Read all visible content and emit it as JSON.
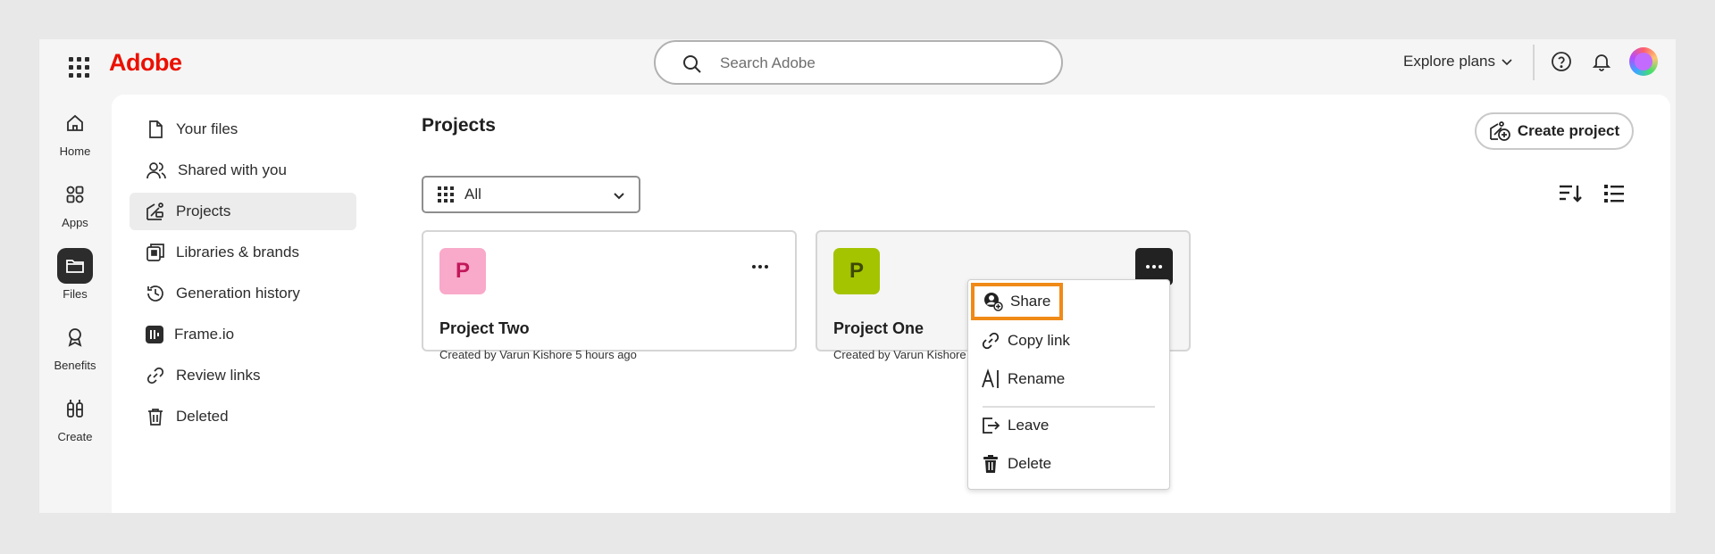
{
  "brand": {
    "logo": "Adobe",
    "color": "#eb1000"
  },
  "header": {
    "search_placeholder": "Search Adobe",
    "explore_label": "Explore plans",
    "icons": [
      "apps-grid-icon",
      "search-icon",
      "help-icon",
      "bell-icon",
      "avatar"
    ]
  },
  "rail": {
    "items": [
      {
        "label": "Home",
        "icon": "home-icon"
      },
      {
        "label": "Apps",
        "icon": "apps-icon"
      },
      {
        "label": "Files",
        "icon": "folder-icon",
        "active": true
      },
      {
        "label": "Benefits",
        "icon": "badge-icon"
      },
      {
        "label": "Create",
        "icon": "create-icon"
      }
    ]
  },
  "sidenav": {
    "items": [
      {
        "label": "Your files",
        "icon": "file-icon"
      },
      {
        "label": "Shared with you",
        "icon": "people-icon"
      },
      {
        "label": "Projects",
        "icon": "project-icon",
        "active": true
      },
      {
        "label": "Libraries & brands",
        "icon": "library-icon"
      },
      {
        "label": "Generation history",
        "icon": "history-icon"
      },
      {
        "label": "Frame.io",
        "icon": "frameio-icon"
      },
      {
        "label": "Review links",
        "icon": "link-icon"
      },
      {
        "label": "Deleted",
        "icon": "trash-icon"
      }
    ]
  },
  "main": {
    "title": "Projects",
    "create_button": "Create project",
    "filter_value": "All"
  },
  "projects": [
    {
      "initial": "P",
      "name": "Project Two",
      "meta": "Created by Varun Kishore 5 hours ago",
      "tile_bg": "#f9a9c9",
      "tile_fg": "#c2185b"
    },
    {
      "initial": "P",
      "name": "Project One",
      "meta": "Created by Varun Kishore",
      "tile_bg": "#a4c400",
      "tile_fg": "#3d4a00"
    }
  ],
  "context_menu": {
    "items": [
      {
        "label": "Share",
        "icon": "share-user-icon",
        "highlighted": true
      },
      {
        "label": "Copy link",
        "icon": "link-icon"
      },
      {
        "label": "Rename",
        "icon": "rename-icon"
      },
      {
        "label": "Leave",
        "icon": "leave-icon"
      },
      {
        "label": "Delete",
        "icon": "trash-icon"
      }
    ],
    "highlight_color": "#f08a17"
  }
}
